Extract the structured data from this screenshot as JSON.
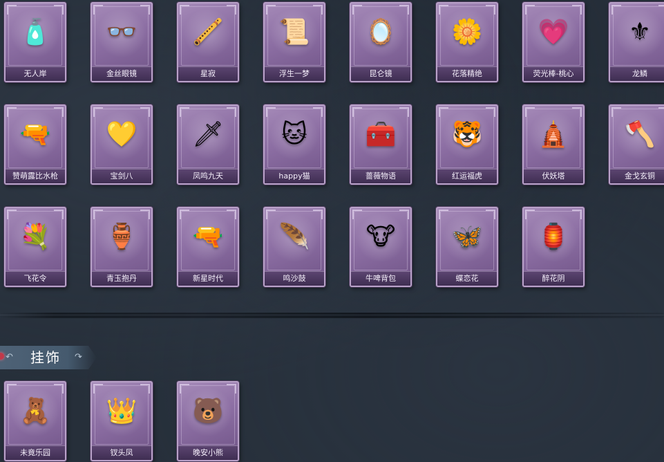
{
  "items": [
    {
      "label": "无人岸",
      "icon": "perfume-bottle-icon",
      "glyph": "🧴"
    },
    {
      "label": "金丝眼镜",
      "icon": "glasses-icon",
      "glyph": "👓"
    },
    {
      "label": "星寂",
      "icon": "blue-flute-icon",
      "glyph": "🪈"
    },
    {
      "label": "浮生一梦",
      "icon": "scroll-icon",
      "glyph": "📜"
    },
    {
      "label": "昆仑镜",
      "icon": "mirror-icon",
      "glyph": "🪞"
    },
    {
      "label": "花落精绝",
      "icon": "flower-pendant-icon",
      "glyph": "🌼"
    },
    {
      "label": "荧光棒-桃心",
      "icon": "heart-wand-icon",
      "glyph": "💗"
    },
    {
      "label": "龙鳞",
      "icon": "golden-shovel-icon",
      "glyph": "⚜"
    },
    {
      "label": "赞萌露比水枪",
      "icon": "water-gun-icon",
      "glyph": "🔫"
    },
    {
      "label": "宝剑八",
      "icon": "heart-locket-icon",
      "glyph": "💛"
    },
    {
      "label": "凤鸣九天",
      "icon": "red-blade-icon",
      "glyph": "🗡"
    },
    {
      "label": "happy猫",
      "icon": "cat-figurine-icon",
      "glyph": "🐱"
    },
    {
      "label": "蔷薇物语",
      "icon": "red-case-icon",
      "glyph": "🧰"
    },
    {
      "label": "红运福虎",
      "icon": "tiger-icon",
      "glyph": "🐯"
    },
    {
      "label": "伏妖塔",
      "icon": "pagoda-icon",
      "glyph": "🛕"
    },
    {
      "label": "金戈玄铜",
      "icon": "bronze-axe-icon",
      "glyph": "🪓"
    },
    {
      "label": "飞花令",
      "icon": "flower-bouquet-icon",
      "glyph": "💐"
    },
    {
      "label": "青玉抱丹",
      "icon": "jade-vase-icon",
      "glyph": "🏺"
    },
    {
      "label": "新星时代",
      "icon": "revolver-icon",
      "glyph": "🔫"
    },
    {
      "label": "鸣沙鼓",
      "icon": "dreamcatcher-icon",
      "glyph": "🪶"
    },
    {
      "label": "牛啤背包",
      "icon": "cow-barrel-icon",
      "glyph": "🐮"
    },
    {
      "label": "蝶恋花",
      "icon": "butterfly-ring-icon",
      "glyph": "🦋"
    },
    {
      "label": "醉花阴",
      "icon": "jeweled-lantern-icon",
      "glyph": "🏮"
    }
  ],
  "section": {
    "title": "挂饰",
    "left_ornament": "↶",
    "right_ornament": "↷"
  },
  "pendants": [
    {
      "label": "未竟乐园",
      "icon": "doll-girl-icon",
      "glyph": "🧸"
    },
    {
      "label": "钗头凤",
      "icon": "phoenix-crown-icon",
      "glyph": "👑"
    },
    {
      "label": "晚安小熊",
      "icon": "bear-icon",
      "glyph": "🐻"
    }
  ]
}
